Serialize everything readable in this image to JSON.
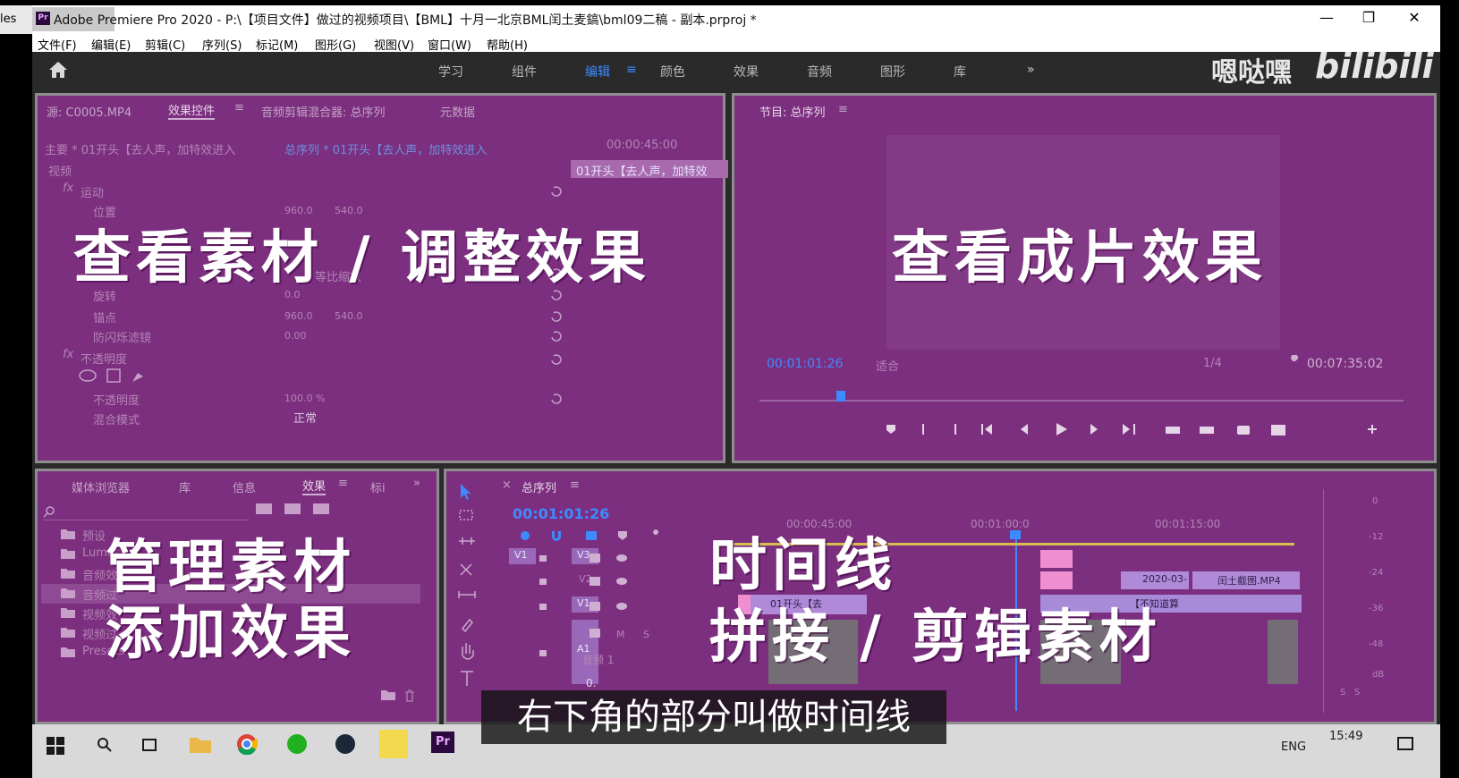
{
  "left_strip": {
    "label": "les"
  },
  "window": {
    "app_name": "Adobe Premiere Pro 2020",
    "title": "Adobe Premiere Pro 2020 - P:\\【项目文件】做过的视频项目\\【BML】十月一北京BML闰土麦鎬\\bml09二稿 - 副本.prproj *",
    "controls": {
      "minimize": "—",
      "restore": "❐",
      "close": "✕"
    }
  },
  "menu": [
    "文件(F)",
    "编辑(E)",
    "剪辑(C)",
    "序列(S)",
    "标记(M)",
    "图形(G)",
    "视图(V)",
    "窗口(W)",
    "帮助(H)"
  ],
  "workspaces": {
    "items": [
      "学习",
      "组件",
      "编辑",
      "颜色",
      "效果",
      "音频",
      "图形",
      "库"
    ],
    "active": "编辑",
    "more": "»"
  },
  "watermark": {
    "name": "嗯哒嘿",
    "logo": "bilibili"
  },
  "source_panel": {
    "tabs": [
      "源: C0005.MP4",
      "效果控件",
      "音频剪辑混合器: 总序列",
      "元数据"
    ],
    "master": "主要 * 01开头【去人声，加特效进入",
    "sequence": "总序列 * 01开头【去人声，加特效进入",
    "timecode": "00:00:45:00",
    "clip_label": "01开头【去人声，加特效",
    "video_label": "视频",
    "motion": "运动",
    "position": {
      "label": "位置",
      "x": "960.0",
      "y": "540.0"
    },
    "rotation": {
      "label": "旋转",
      "value": "0.0"
    },
    "anchor": {
      "label": "锚点",
      "x": "960.0",
      "y": "540.0"
    },
    "flicker": {
      "label": "防闪烁滤镜",
      "value": "0.00"
    },
    "opacity_group": "不透明度",
    "opacity": {
      "label": "不透明度",
      "value": "100.0 %"
    },
    "blend": {
      "label": "混合模式",
      "value": "正常"
    },
    "scale_hint": "等比缩放",
    "caption": "查看素材 / 调整效果"
  },
  "program_panel": {
    "tab": "节目: 总序列",
    "timecode": "00:01:01:26",
    "fit": "适合",
    "ratio": "1/4",
    "duration": "00:07:35:02",
    "caption": "查看成片效果"
  },
  "project_panel": {
    "tabs": [
      "媒体浏览器",
      "库",
      "信息",
      "效果",
      "标i"
    ],
    "folders": [
      "预设",
      "Lumet",
      "音频效",
      "音频过",
      "视频效",
      "视频过",
      "Presets"
    ],
    "caption_line1": "管理素材",
    "caption_line2": "添加效果"
  },
  "timeline_panel": {
    "tab": "总序列",
    "timecode": "00:01:01:26",
    "ruler": [
      "00:00:45:00",
      "00:01:00:0",
      "00:01:15:00"
    ],
    "tracks": [
      "V3",
      "V2",
      "V1",
      "A1"
    ],
    "source_track": "V1",
    "audio_label": "音频 1",
    "audio_toggles": [
      "M",
      "S"
    ],
    "volume": "0.",
    "clips": [
      "01开头【去",
      "2020-03-",
      "闰土截图.MP4",
      "【不知道算"
    ],
    "meter": [
      "0",
      "-12",
      "-24",
      "-36",
      "-48",
      "dB"
    ],
    "meter_bottom": [
      "S",
      "S"
    ],
    "caption_line1": "时间线",
    "caption_line2": "拼接 / 剪辑素材"
  },
  "subtitle": "右下角的部分叫做时间线",
  "taskbar": {
    "lang": "ENG",
    "time": "15:49"
  }
}
